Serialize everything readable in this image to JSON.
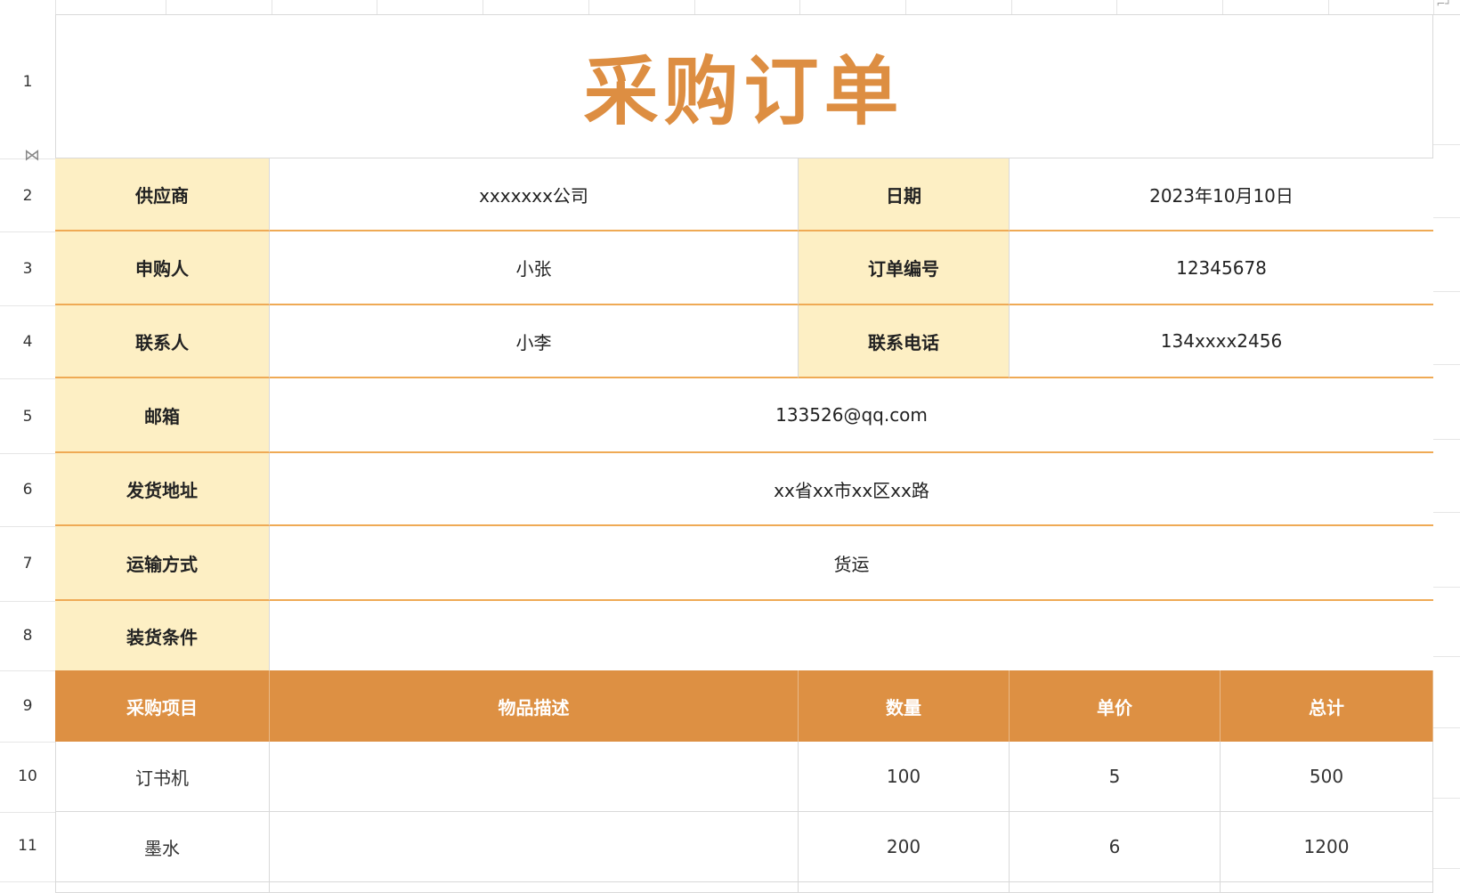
{
  "row_numbers": [
    "1",
    "2",
    "3",
    "4",
    "5",
    "6",
    "7",
    "8",
    "9",
    "10",
    "11"
  ],
  "icons": {
    "freeze_handle": "freeze-pane-handle-icon",
    "corner": "sheet-corner-icon"
  },
  "colors": {
    "title": "#dd8e42",
    "label_bg": "#fdefc4",
    "header_bg": "#dd9043",
    "border_accent": "#efaa55"
  },
  "title": "采购订单",
  "info": {
    "supplier_label": "供应商",
    "supplier_value": "xxxxxxx公司",
    "date_label": "日期",
    "date_value": "2023年10月10日",
    "requester_label": "申购人",
    "requester_value": "小张",
    "order_no_label": "订单编号",
    "order_no_value": "12345678",
    "contact_label": "联系人",
    "contact_value": "小李",
    "phone_label": "联系电话",
    "phone_value": "134xxxx2456",
    "email_label": "邮箱",
    "email_value": "133526@qq.com",
    "address_label": "发货地址",
    "address_value": "xx省xx市xx区xx路",
    "shipping_label": "运输方式",
    "shipping_value": "货运",
    "terms_label": "装货条件",
    "terms_value": ""
  },
  "table": {
    "headers": [
      "采购项目",
      "物品描述",
      "数量",
      "单价",
      "总计"
    ],
    "rows": [
      {
        "item": "订书机",
        "desc": "",
        "qty": "100",
        "price": "5",
        "total": "500"
      },
      {
        "item": "墨水",
        "desc": "",
        "qty": "200",
        "price": "6",
        "total": "1200"
      }
    ]
  }
}
